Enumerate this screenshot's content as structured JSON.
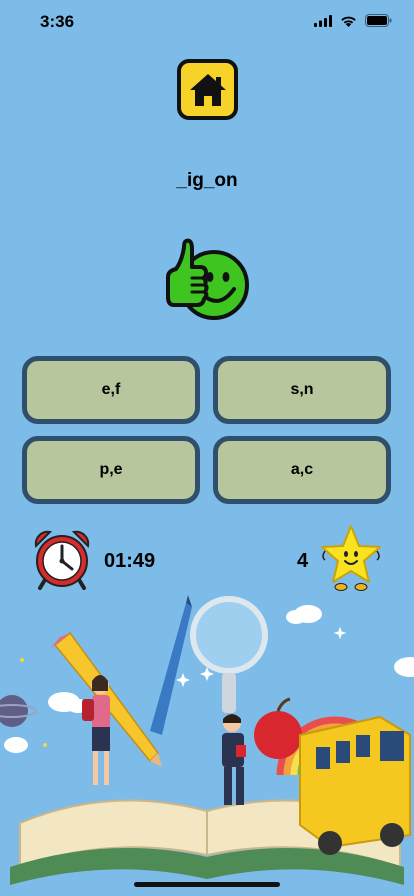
{
  "status_bar": {
    "time": "3:36"
  },
  "puzzle": {
    "word": "_ig_on"
  },
  "answers": [
    {
      "label": "e,f"
    },
    {
      "label": "s,n"
    },
    {
      "label": "p,e"
    },
    {
      "label": "a,c"
    }
  ],
  "timer": {
    "value": "01:49"
  },
  "score": {
    "value": "4"
  },
  "icons": {
    "home": "home-icon",
    "feedback": "thumbs-up-smiley-icon",
    "timer": "alarm-clock-icon",
    "score": "star-icon"
  },
  "colors": {
    "background": "#7dbbe8",
    "home_button": "#f7d229",
    "answer_fill": "#b7c69c",
    "answer_border": "#2f4f6a",
    "feedback_green": "#3ec520"
  }
}
